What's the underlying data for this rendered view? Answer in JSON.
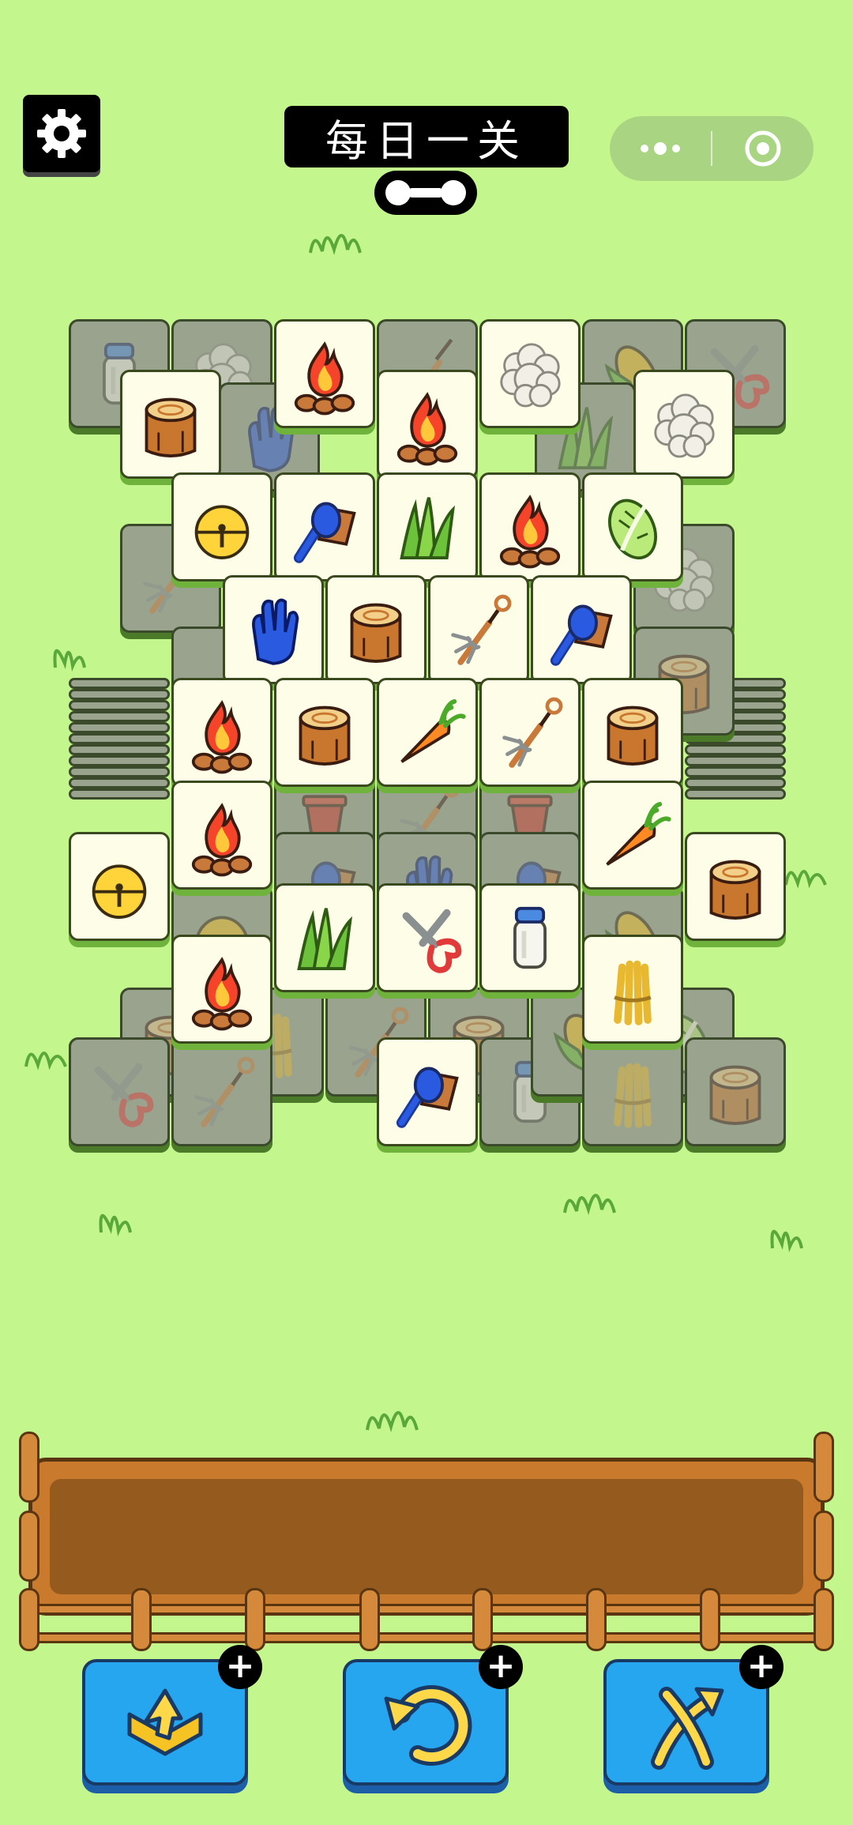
{
  "header": {
    "title": "每日一关",
    "settings_icon": "gear-icon",
    "menu_icon": "more-dots-icon",
    "close_icon": "target-circle-icon"
  },
  "board": {
    "covered_tiles": [
      "milk-bottle",
      "wool",
      "shovel",
      "corn",
      "pruning-shears",
      "glove",
      "grass",
      "fork",
      "wool",
      "fork",
      "stump",
      "cabbage",
      "fork",
      "stump",
      "flower-pot",
      "fork",
      "flower-pot",
      "brush",
      "glove",
      "brush",
      "beehive",
      "corn",
      "stump",
      "fork",
      "wheat",
      "fork",
      "stump",
      "fork",
      "fork",
      "milk-bottle",
      "corn",
      "cabbage",
      "pruning-shears",
      "wheat",
      "stump"
    ],
    "top_tiles": [
      "stump",
      "campfire",
      "campfire",
      "wool",
      "wool",
      "bell",
      "brush",
      "grass",
      "campfire",
      "cabbage",
      "glove",
      "stump",
      "fork",
      "brush",
      "campfire",
      "stump",
      "carrot",
      "fork",
      "stump",
      "campfire",
      "carrot",
      "bell",
      "grass",
      "pruning-shears",
      "milk-bottle",
      "campfire",
      "wheat",
      "stump",
      "brush"
    ]
  },
  "tray": {
    "slots": []
  },
  "tools": [
    {
      "name": "undo-out",
      "icon": "box-out-icon",
      "badge": "+"
    },
    {
      "name": "undo",
      "icon": "undo-arrow-icon",
      "badge": "+"
    },
    {
      "name": "shuffle",
      "icon": "shuffle-arrows-icon",
      "badge": "+"
    }
  ],
  "colors": {
    "background": "#c3f78e",
    "tile_face": "#fefde8",
    "tile_dim": "#9aa38e",
    "tool_button": "#27a6f0",
    "tray": "#c97a2c"
  }
}
